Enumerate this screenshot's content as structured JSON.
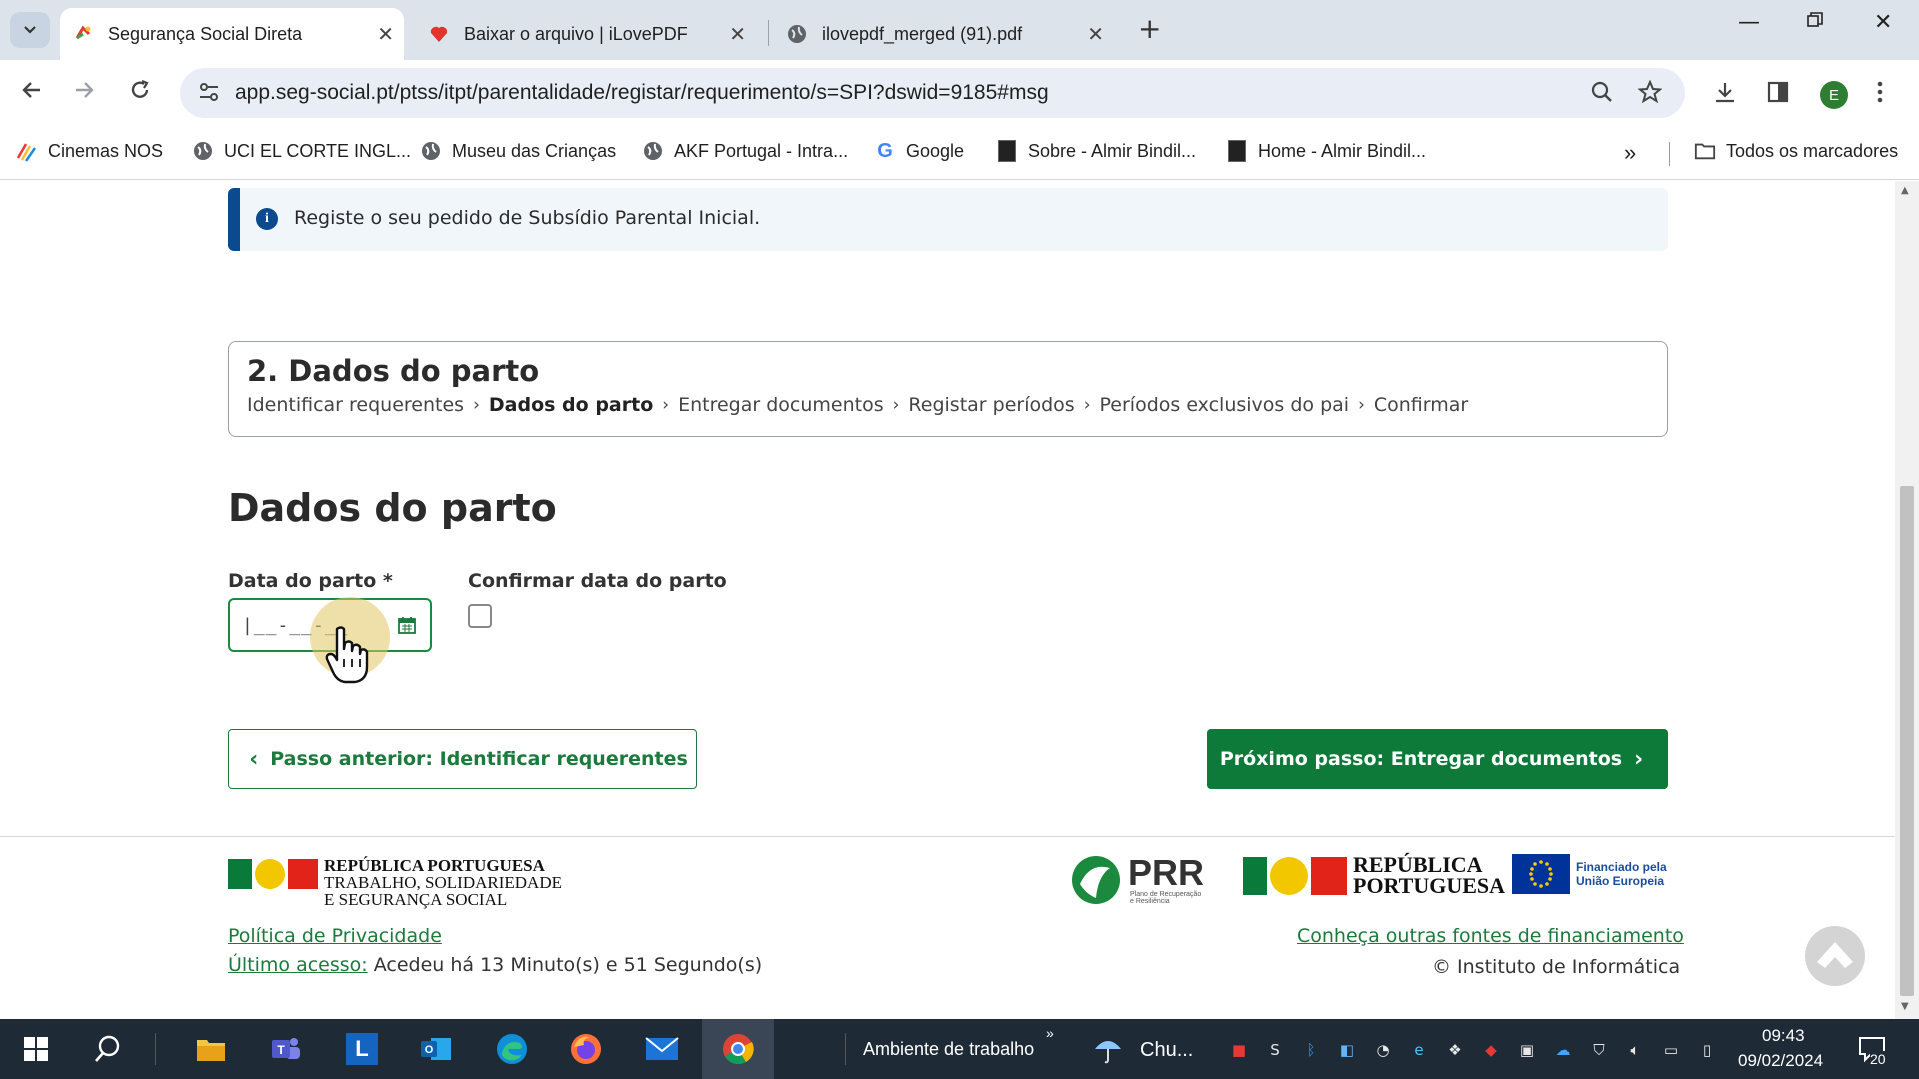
{
  "browser": {
    "tabs": [
      {
        "title": "Segurança Social Direta",
        "active": true
      },
      {
        "title": "Baixar o arquivo | iLovePDF",
        "active": false
      },
      {
        "title": "ilovepdf_merged (91).pdf",
        "active": false
      }
    ],
    "url": "app.seg-social.pt/ptss/itpt/parentalidade/registar/requerimento/s=SPI?dswid=9185#msg",
    "profile_initial": "E",
    "bookmarks": [
      "Cinemas NOS",
      "UCI EL CORTE INGL...",
      "Museu das Crianças",
      "AKF Portugal - Intra...",
      "Google",
      "Sobre - Almir Bindil...",
      "Home - Almir Bindil..."
    ],
    "all_bookmarks": "Todos os marcadores"
  },
  "page": {
    "info_text": "Registe o seu pedido de Subsídio Parental Inicial.",
    "step_title": "2. Dados do parto",
    "steps": [
      "Identificar requerentes",
      "Dados do parto",
      "Entregar documentos",
      "Registar períodos",
      "Períodos exclusivos do pai",
      "Confirmar"
    ],
    "current_step": 1,
    "heading": "Dados do parto",
    "date_label": "Data do parto *",
    "date_mask": "|__-__-__",
    "confirm_label": "Confirmar data do parto",
    "prev_button": "Passo anterior: Identificar requerentes",
    "next_button": "Próximo passo: Entregar documentos"
  },
  "footer": {
    "logo_line1": "REPÚBLICA PORTUGUESA",
    "logo_line2": "TRABALHO, SOLIDARIEDADE",
    "logo_line3": "E SEGURANÇA SOCIAL",
    "prr": "PRR",
    "prr_sub1": "Plano de Recuperação",
    "prr_sub2": "e Resiliência",
    "rp_line1": "REPÚBLICA",
    "rp_line2": "PORTUGUESA",
    "eu_line1": "Financiado pela",
    "eu_line2": "União Europeia",
    "privacy": "Política de Privacidade",
    "last_access_label": "Último acesso:",
    "last_access_value": " Acedeu há 13 Minuto(s) e 51 Segundo(s)",
    "funding_link": "Conheça outras fontes de financiamento",
    "copyright": "© Instituto de Informática"
  },
  "taskbar": {
    "desktop_label": "Ambiente de trabalho",
    "weather": "Chu...",
    "time": "09:43",
    "date": "09/02/2024",
    "notifications": "20"
  },
  "colors": {
    "primary_green": "#0d7a3a",
    "info_blue": "#0b4a8f"
  }
}
